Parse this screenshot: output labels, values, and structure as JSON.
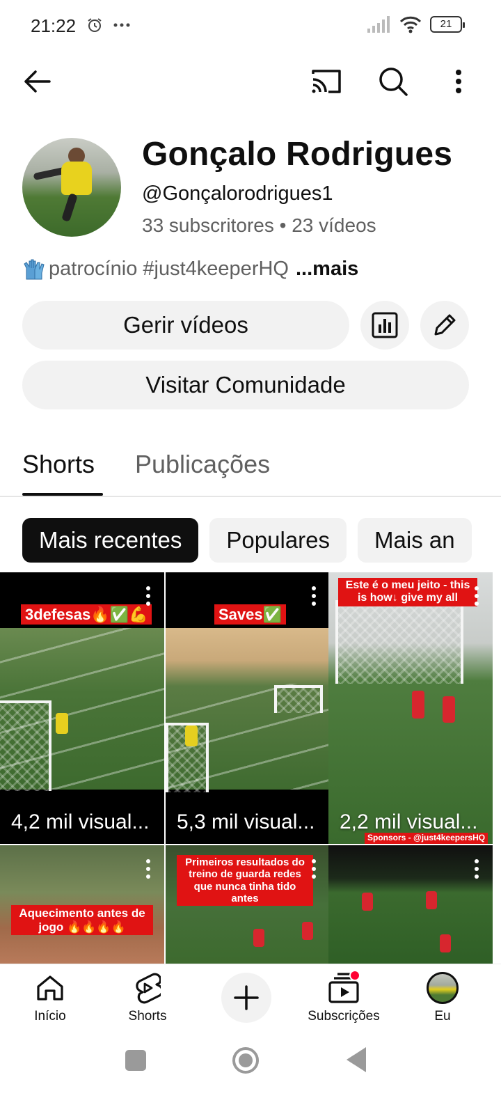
{
  "status_bar": {
    "time": "21:22",
    "battery": "21"
  },
  "channel": {
    "name": "Gonçalo Rodrigues",
    "handle": "@Gonçalorodrigues1",
    "stats": "33 subscritores • 23 vídeos",
    "description": "patrocínio #just4keeperHQ",
    "more_label": "...mais"
  },
  "actions": {
    "manage_videos": "Gerir vídeos",
    "visit_community": "Visitar Comunidade"
  },
  "tabs": [
    {
      "label": "Shorts",
      "active": true
    },
    {
      "label": "Publicações",
      "active": false
    }
  ],
  "chips": [
    {
      "label": "Mais recentes",
      "selected": true
    },
    {
      "label": "Populares",
      "selected": false
    },
    {
      "label": "Mais an",
      "selected": false
    }
  ],
  "shorts": [
    {
      "caption": "3defesas🔥✅💪",
      "views": "4,2 mil visual..."
    },
    {
      "caption": "Saves✅",
      "views": "5,3 mil visual..."
    },
    {
      "caption": "Este é o meu jeito - this is how↓ give my all",
      "views": "2,2 mil visual...",
      "footer": "Sponsors - @just4keepersHQ"
    },
    {
      "caption": "Aquecimento antes de jogo 🔥🔥🔥🔥",
      "views": ""
    },
    {
      "caption": "Primeiros resultados do treino de guarda redes que nunca tinha tido antes",
      "views": ""
    },
    {
      "caption": "",
      "views": ""
    }
  ],
  "bottom_nav": [
    {
      "label": "Início",
      "icon": "home-icon"
    },
    {
      "label": "Shorts",
      "icon": "shorts-icon"
    },
    {
      "label": "",
      "icon": "create-icon"
    },
    {
      "label": "Subscrições",
      "icon": "subscriptions-icon"
    },
    {
      "label": "Eu",
      "icon": "avatar"
    }
  ],
  "colors": {
    "accent_red": "#e01313",
    "chip_selected": "#0f0f0f",
    "pill_bg": "#f2f2f2",
    "badge_red": "#ff0033"
  }
}
